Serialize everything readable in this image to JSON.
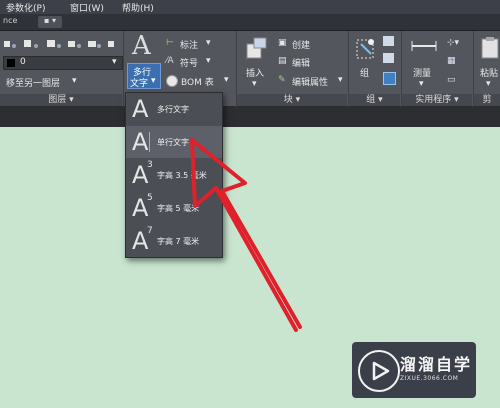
{
  "menubar": {
    "items": [
      "参数化(P)",
      "窗口(W)",
      "帮助(H)"
    ]
  },
  "tabbar": {
    "tab_fragment": "nce"
  },
  "ribbon": {
    "layer_value": "0",
    "move_layer": "移至另一图层",
    "panels": {
      "layers": "图层 ▾",
      "block": "块 ▾",
      "group": "组 ▾",
      "utilities": "实用程序 ▾",
      "clipboard": "剪"
    },
    "text_button": [
      "多行",
      "文字"
    ],
    "annotation": {
      "mark": "标注",
      "symbol": "符号",
      "bom": "BOM 表"
    },
    "block": {
      "insert": "插入",
      "create": "创建",
      "edit": "编辑",
      "edit_attr": "编辑属性"
    },
    "group": {
      "group": "组"
    },
    "utilities": {
      "measure": "测量"
    },
    "clipboard": {
      "paste": "粘贴"
    }
  },
  "dropdown": {
    "items": [
      {
        "label": "多行文字",
        "sup": ""
      },
      {
        "label": "单行文字",
        "sup": ""
      },
      {
        "label": "字高 3.5 毫米",
        "sup": "3"
      },
      {
        "label": "字高 5 毫米",
        "sup": "5"
      },
      {
        "label": "字高 7 毫米",
        "sup": "7"
      }
    ]
  },
  "watermark": {
    "title": "溜溜自学",
    "url": "ZIXUE.3066.COM"
  },
  "colors": {
    "arrow": "#e0202a",
    "canvas": "#c9e5d0",
    "ribbon": "#53565c"
  }
}
